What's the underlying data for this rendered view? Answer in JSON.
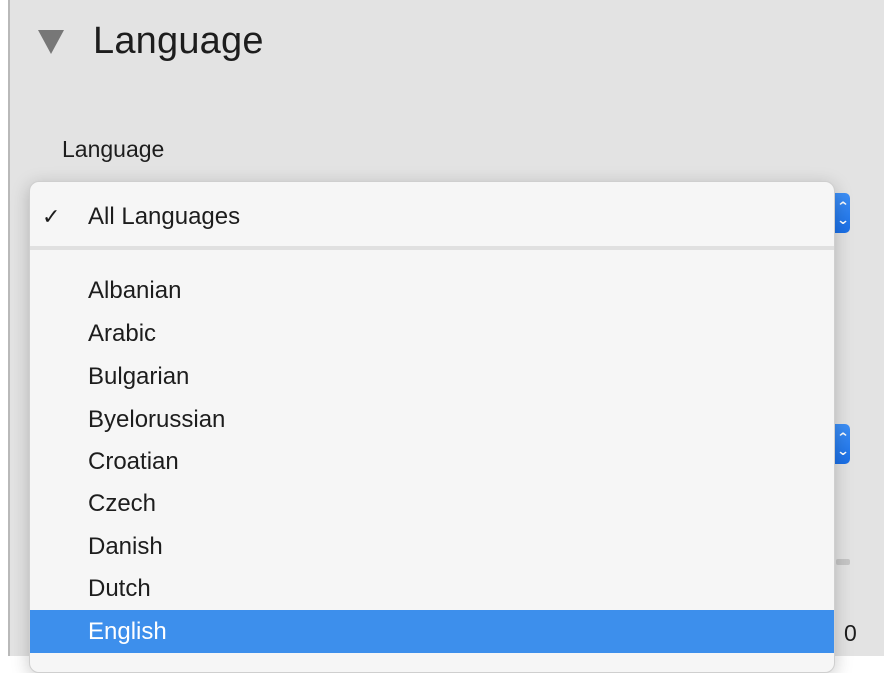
{
  "section": {
    "title": "Language",
    "disclosure_icon": "triangle-down-icon"
  },
  "field": {
    "label": "Language"
  },
  "menu": {
    "checked_item": {
      "check": "✓",
      "label": "All Languages"
    },
    "items": [
      {
        "label": "Albanian"
      },
      {
        "label": "Arabic"
      },
      {
        "label": "Bulgarian"
      },
      {
        "label": "Byelorussian"
      },
      {
        "label": "Croatian"
      },
      {
        "label": "Czech"
      },
      {
        "label": "Danish"
      },
      {
        "label": "Dutch"
      },
      {
        "label": "English"
      }
    ],
    "highlighted_label": "English"
  },
  "background": {
    "trailing_glyph": "0"
  },
  "colors": {
    "panel_bg": "#e3e3e3",
    "menu_bg": "#f6f6f6",
    "highlight": "#3d8fec",
    "stepper": "#1a6fe6"
  }
}
